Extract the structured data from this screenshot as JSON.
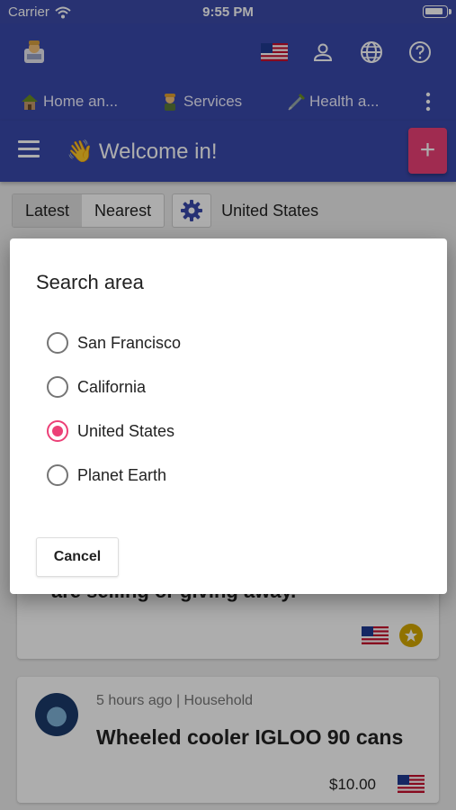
{
  "status": {
    "carrier": "Carrier",
    "time": "9:55 PM"
  },
  "header": {
    "icons": [
      "us-flag-icon",
      "person-icon",
      "globe-icon",
      "help-icon"
    ],
    "tabs": [
      {
        "label": "Home an..."
      },
      {
        "label": "Services"
      },
      {
        "label": "Health a..."
      }
    ]
  },
  "welcome": {
    "emoji": "👋",
    "title": "Welcome in!",
    "add_label": "+"
  },
  "filters": {
    "latest": "Latest",
    "nearest": "Nearest",
    "country": "United States"
  },
  "cards": [
    {
      "title": "are selling or giving away."
    },
    {
      "meta": "5 hours ago | Household",
      "title": "Wheeled cooler IGLOO 90 cans",
      "price": "$10.00"
    }
  ],
  "dialog": {
    "title": "Search area",
    "options": [
      {
        "label": "San Francisco",
        "selected": false
      },
      {
        "label": "California",
        "selected": false
      },
      {
        "label": "United States",
        "selected": true
      },
      {
        "label": "Planet Earth",
        "selected": false
      }
    ],
    "cancel_label": "Cancel"
  },
  "colors": {
    "primary": "#3949ab",
    "accent": "#ec4077",
    "star": "#d4a900"
  }
}
